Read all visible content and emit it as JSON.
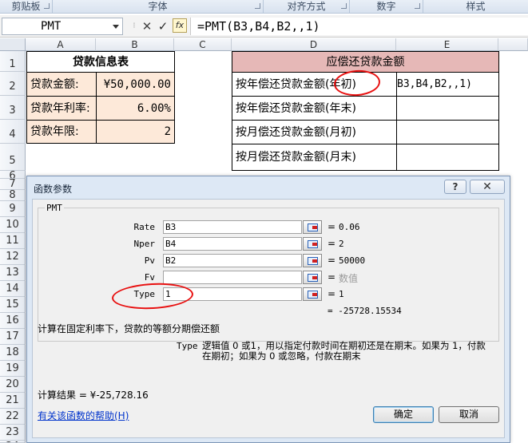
{
  "ribbon": {
    "groups": [
      "剪贴板",
      "字体",
      "对齐方式",
      "数字",
      "样式"
    ]
  },
  "formula_bar": {
    "name_box": "PMT",
    "cancel_icon": "✕",
    "enter_icon": "✓",
    "fx_label": "fx",
    "formula": "=PMT(B3,B4,B2,,1)"
  },
  "columns": [
    "A",
    "B",
    "C",
    "D",
    "E"
  ],
  "rows": [
    "1",
    "2",
    "3",
    "4",
    "5",
    "6",
    "7",
    "8",
    "9",
    "10",
    "11",
    "12",
    "13",
    "14",
    "15",
    "16",
    "17",
    "18",
    "19",
    "20",
    "21",
    "22",
    "23",
    "24"
  ],
  "sheet": {
    "loan_title": "贷款信息表",
    "amount_label": "贷款金额:",
    "amount_value": "¥50,000.00",
    "rate_label": "贷款年利率:",
    "rate_value": "6.00%",
    "years_label": "贷款年限:",
    "years_value": "2",
    "pay_title": "应偿还贷款金额",
    "row_year_begin": "按年偿还贷款金额(年初)",
    "row_year_end": "按年偿还贷款金额(年末)",
    "row_month_begin": "按月偿还贷款金额(月初)",
    "row_month_end": "按月偿还贷款金额(月末)",
    "e2_overflow": "B3,B4,B2,,1)"
  },
  "dialog": {
    "title": "函数参数",
    "help_button": "?",
    "close_icon": "✕",
    "function_name": "PMT",
    "args": [
      {
        "label": "Rate",
        "value": "B3",
        "result": "0.06"
      },
      {
        "label": "Nper",
        "value": "B4",
        "result": "2"
      },
      {
        "label": "Pv",
        "value": "B2",
        "result": "50000"
      },
      {
        "label": "Fv",
        "value": "",
        "result": "数值"
      },
      {
        "label": "Type",
        "value": "1",
        "result": "1"
      }
    ],
    "function_result": "= -25728.15534",
    "description": "计算在固定利率下，贷款的等额分期偿还额",
    "param_name": "Type",
    "param_desc_line1": "逻辑值 0 或1，用以指定付款时间在期初还是在期末。如果为 1，付款",
    "param_desc_line2": "在期初；如果为 0 或忽略，付款在期末",
    "calc_result": "计算结果 = ¥-25,728.16",
    "help_link": "有关该函数的帮助(H)",
    "ok_button": "确定",
    "cancel_button": "取消"
  },
  "colors": {
    "peach_fill": "#fde9d9",
    "pink_fill": "#e6b8b7",
    "annotation_red": "#e81010"
  }
}
